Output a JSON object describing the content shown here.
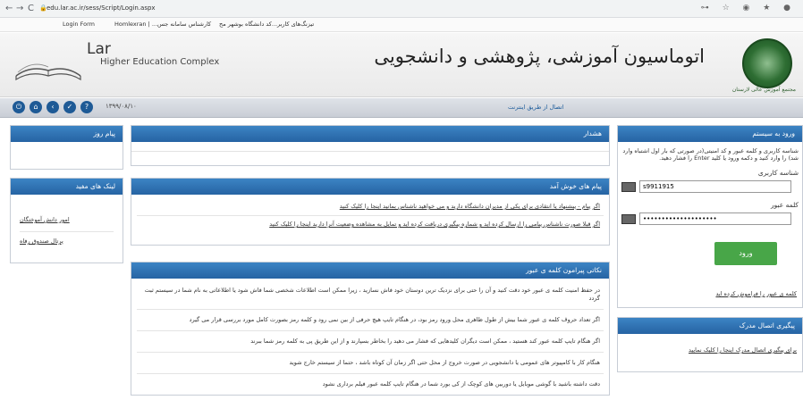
{
  "browser": {
    "url": "edu.lar.ac.ir/sess/Script/Login.aspx",
    "bookmarks": [
      "تیزنگ‌های کاربر",
      "کد دانشگاه بوشهر مح...",
      "کارشناس سامانه جس",
      "Homlexran | ...",
      "Login Form"
    ]
  },
  "header": {
    "english_title": "Lar",
    "english_subtitle": "Higher Education Complex",
    "persian_title": "اتوماسیون آموزشی، پژوهشی و دانشجویی",
    "emblem_caption": "مجتمع آموزش عالی لارستان"
  },
  "navstrip": {
    "date": "۱۳۹۹/۰۸/۱۰",
    "link": "اتصال از طریق اینترنت"
  },
  "panels": {
    "today_message": {
      "title": "پیام روز"
    },
    "warning": {
      "title": "هشدار"
    },
    "useful_links": {
      "title": "لینک های مفید",
      "items": [
        "امور دانش آموختگان",
        "پرتال صندوق رفاه"
      ]
    },
    "welcome": {
      "title": "پیام های خوش آمد",
      "items": [
        "اگر پیام - پیشنهاد یا انتقادی برای یکی از مدیران دانشگاه دارید و می خواهید ناشناس بمانید اینجا را کلیک کنید",
        "اگر قبلا صورت ناشناس پیامی را ارسال کرده اید و شماره پیگیری دریافت کرده اید و تمایل به مشاهده وضعیت آنرا دارید اینجا را کلیک کنید"
      ]
    },
    "password_tips": {
      "title": "نکاتی پیرامون کلمه ی عبور",
      "items": [
        "در حفظ امنیت کلمه ی عبور خود دقت کنید و آن را حتی برای نزدیک ترین دوستان خود فاش نسازید ، زیرا ممکن است اطلاعات شخصی شما فاش شود یا اطلاعاتی به نام شما در سیستم ثبت گردد",
        "اگر تعداد حروف کلمه ی عبور شما بیش از طول ظاهری محل ورود رمز بود، در هنگام تایپ هیچ حرفی از بین نمی رود و کلمه رمز بصورت کامل مورد بررسی قرار می گیرد",
        "اگر هنگام تایپ کلمه عبور کند هستید ، ممکن است دیگران کلیدهایی که فشار می دهید را بخاطر بسپارند و از این طریق پی به کلمه رمز شما ببرند",
        "هنگام کار با کامپیوتر های عمومی یا دانشجویی در صورت خروج از محل حتی اگر زمان آن کوتاه باشد ، حتما از سیستم خارج شوید",
        "دقت داشته باشید با گوشی موبایل یا دوربین های کوچک از کی بورد شما در هنگام تایپ کلمه عبور فیلم برداری نشود"
      ]
    },
    "login": {
      "title": "ورود به سیستم",
      "intro": "شناسه کاربری و کلمه عبور و کد امنیتی(در صورتی که بار اول اشتباه وارد شد) را وارد کنید و دکمه ورود یا کلید Enter را فشار دهید.",
      "user_label": "شناسه کاربری",
      "user_value": "s9911915",
      "pass_label": "کلمه عبور",
      "pass_value": "••••••••••••••••••••",
      "login_button": "ورود",
      "forgot_link": "کلمه ی عبور را فراموش کرده اید"
    },
    "tracking": {
      "title": "پیگیری اتصال مدرک",
      "link": "برای پیگیری اتصال مدرک اینجا را کلیک نمایید"
    }
  }
}
